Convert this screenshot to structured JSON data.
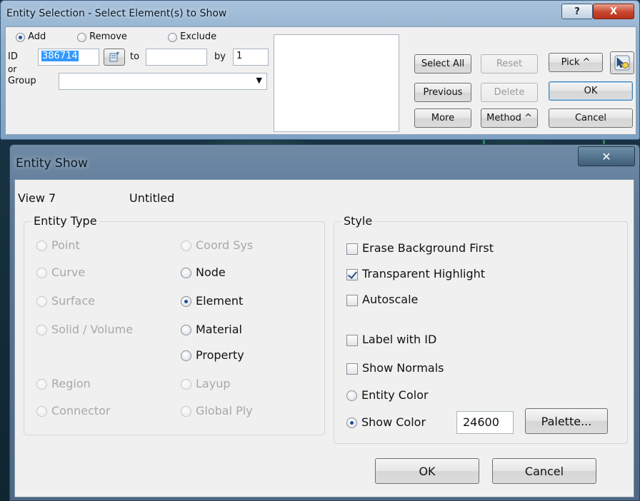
{
  "selection_dialog": {
    "title": "Entity Selection - Select Element(s) to Show",
    "help_glyph": "?",
    "close_glyph": "X",
    "mode": {
      "add": "Add",
      "remove": "Remove",
      "exclude": "Exclude",
      "selected": "add"
    },
    "id_label": "ID",
    "id_value": "386714",
    "to_label": "to",
    "to_value": "",
    "by_label": "by",
    "by_value": "1",
    "or_label": "or",
    "group_label": "Group",
    "group_value": "",
    "buttons": {
      "select_all": "Select All",
      "reset": "Reset",
      "pick": "Pick ^",
      "previous": "Previous",
      "delete": "Delete",
      "ok": "OK",
      "more": "More",
      "method": "Method ^",
      "cancel": "Cancel"
    }
  },
  "show_dialog": {
    "title": "Entity Show",
    "close_glyph": "✕",
    "view_label": "View 7",
    "view_name": "Untitled",
    "entity_type": {
      "legend": "Entity Type",
      "point": "Point",
      "curve": "Curve",
      "surface": "Surface",
      "solid": "Solid / Volume",
      "region": "Region",
      "connector": "Connector",
      "coord_sys": "Coord Sys",
      "node": "Node",
      "element": "Element",
      "material": "Material",
      "property": "Property",
      "layup": "Layup",
      "global_ply": "Global Ply",
      "selected": "element"
    },
    "style": {
      "legend": "Style",
      "erase_background": "Erase Background First",
      "transparent_highlight": "Transparent Highlight",
      "autoscale": "Autoscale",
      "label_with_id": "Label with ID",
      "show_normals": "Show Normals",
      "entity_color": "Entity Color",
      "show_color": "Show Color",
      "color_value": "24600",
      "palette": "Palette...",
      "checked": [
        "transparent_highlight"
      ],
      "selected_color_mode": "show_color"
    },
    "ok": "OK",
    "cancel": "Cancel"
  }
}
